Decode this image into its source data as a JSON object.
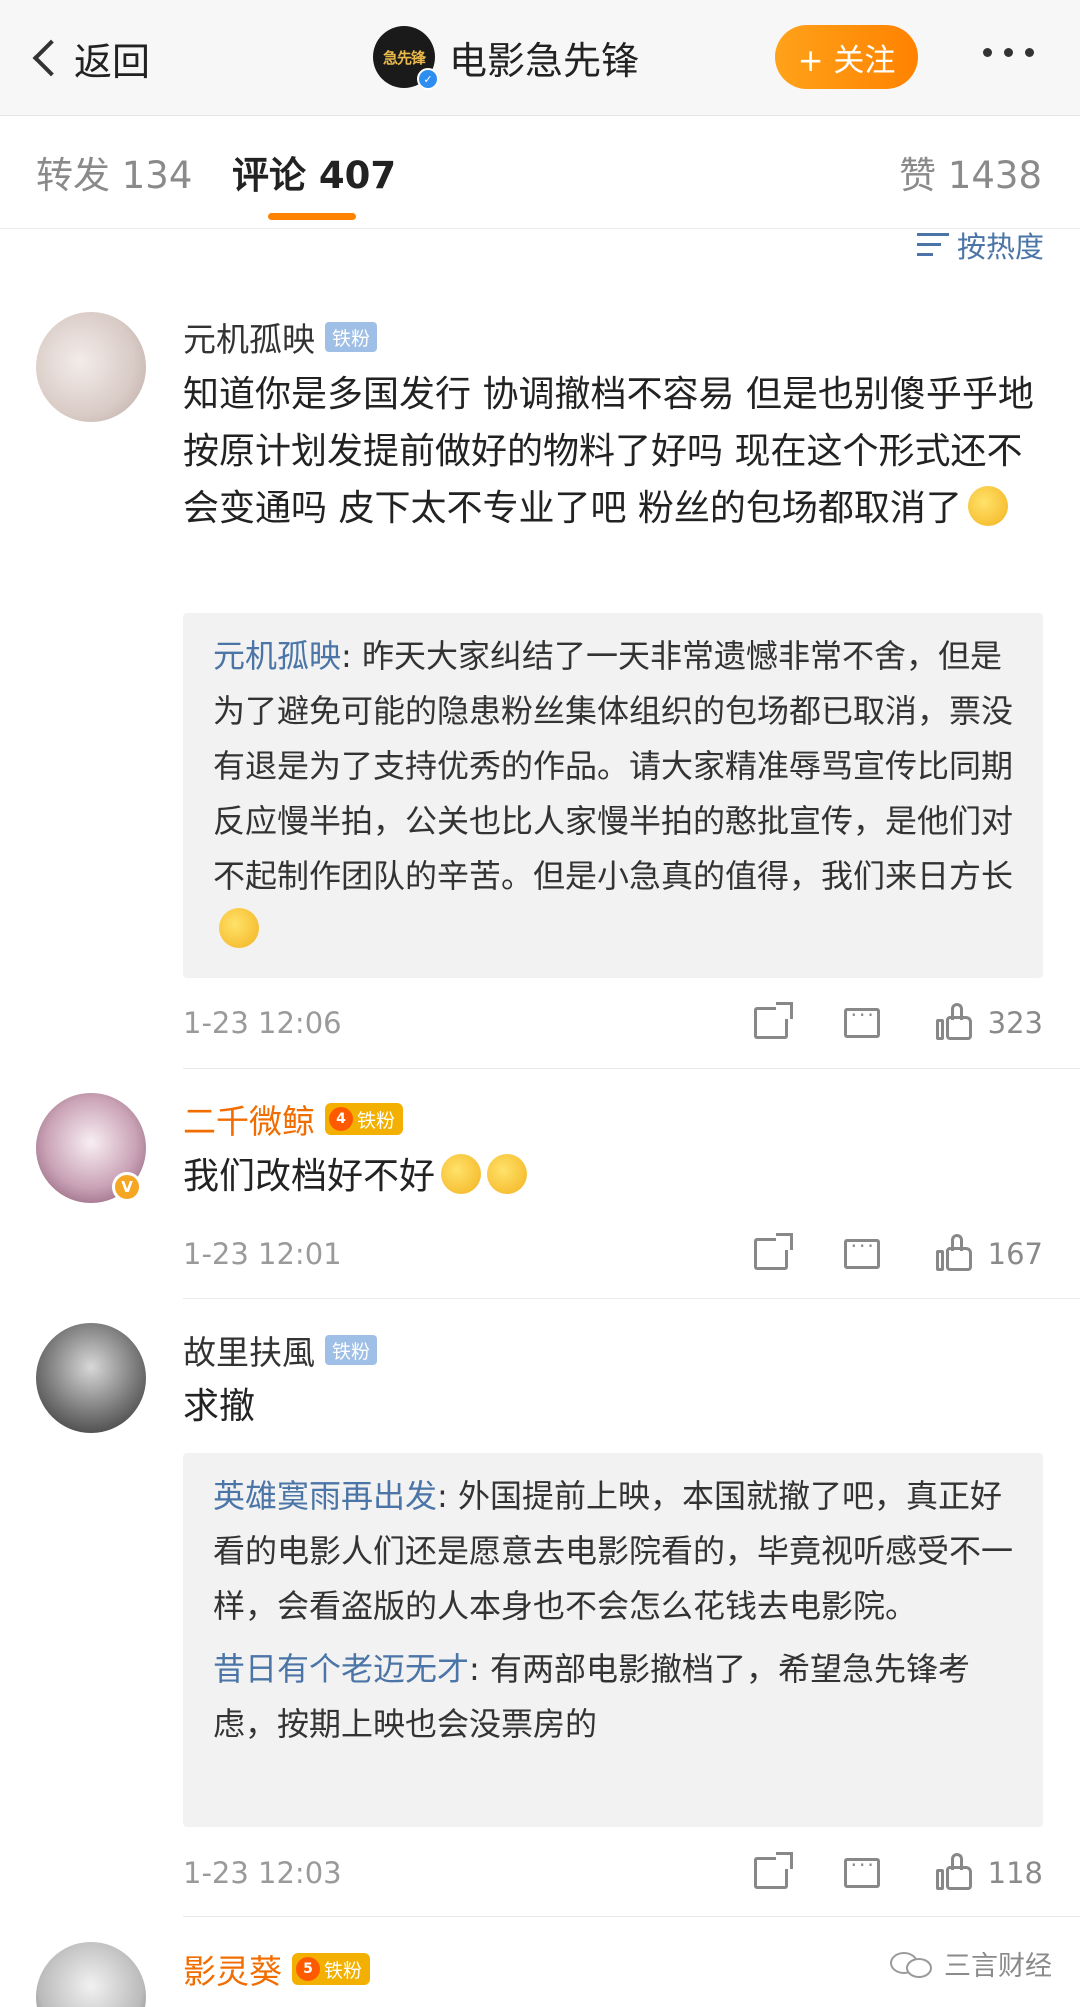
{
  "header": {
    "back_label": "返回",
    "logo_text": "急先锋",
    "title": "电影急先锋",
    "follow_label": "+ 关注"
  },
  "tabs": {
    "repost": "转发 134",
    "comment": "评论 407",
    "like": "赞 1438",
    "sort_label": "按热度"
  },
  "comments": [
    {
      "name": "元机孤映",
      "fan_badge": "铁粉",
      "text": "知道你是多国发行 协调撤档不容易 但是也别傻乎乎地按原计划发提前做好的物料了好吗 现在这个形式还不会变通吗 皮下太不专业了吧 粉丝的包场都取消了",
      "replies": [
        {
          "author": "元机孤映",
          "text": "昨天大家纠结了一天非常遗憾非常不舍，但是为了避免可能的隐患粉丝集体组织的包场都已取消，票没有退是为了支持优秀的作品。请大家精准辱骂宣传比同期反应慢半拍，公关也比人家慢半拍的憨批宣传，是他们对不起制作团队的辛苦。但是小急真的值得，我们来日方长"
        }
      ],
      "time": "1-23 12:06",
      "likes": "323"
    },
    {
      "name": "二千微鲸",
      "fan_badge": "铁粉",
      "crown_level": "4",
      "text": "我们改档好不好",
      "time": "1-23 12:01",
      "likes": "167"
    },
    {
      "name": "故里扶風",
      "fan_badge": "铁粉",
      "text": "求撤",
      "replies": [
        {
          "author": "英雄寞雨再出发",
          "text": "外国提前上映，本国就撤了吧，真正好看的电影人们还是愿意去电影院看的，毕竟视听感受不一样，会看盗版的人本身也不会怎么花钱去电影院。"
        },
        {
          "author": "昔日有个老迈无才",
          "text": "有两部电影撤档了，希望急先锋考虑，按期上映也会没票房的"
        }
      ],
      "time": "1-23 12:03",
      "likes": "118"
    },
    {
      "name": "影灵葵",
      "fan_badge": "铁粉",
      "crown_level": "5"
    }
  ],
  "watermark": "三言财经",
  "colors": {
    "accent": "#ff8200",
    "link": "#4b74a7",
    "fan_badge": "#9fbfe6",
    "highlight_name": "#f26d00"
  }
}
